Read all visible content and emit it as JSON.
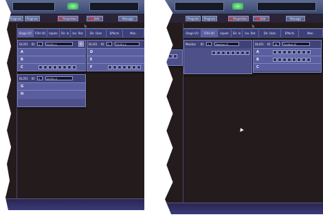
{
  "panels": [
    {
      "toolbar": {
        "tb1": "Program",
        "tb2": "Program",
        "tb3": "Properties",
        "tb4": "Edit",
        "tb5": "Manage"
      },
      "tag": "To",
      "tabs": [
        "Stage I/O",
        "FOH I/O",
        "Inputs",
        "Dir. In",
        "Ins. Ret.",
        "Dir. Outs",
        "Effects",
        "Mon."
      ],
      "groups": [
        {
          "title": "DL351",
          "id_label": "ID",
          "id": "1",
          "name": "DL351-1",
          "rows": [
            "A",
            "B",
            "C"
          ]
        },
        {
          "title": "DL351",
          "id_label": "ID",
          "id": "2",
          "name": "DL351-2",
          "rows": [
            "D",
            "E",
            "F"
          ]
        },
        {
          "title": "DL351",
          "id_label": "ID",
          "id": "3",
          "name": "DL351-3",
          "rows": [
            "G",
            "H"
          ]
        }
      ]
    },
    {
      "toolbar": {
        "tb1": "Program",
        "tb2": "Program",
        "tb3": "Properties",
        "tb4": "Edit",
        "tb5": "Manage"
      },
      "tag": "To",
      "tabs": [
        "Stage I/O",
        "FOH I/O",
        "Inputs",
        "Dir. In",
        "Ins. Ret.",
        "Dir. Outs",
        "Effects",
        "Mon."
      ],
      "groups": [
        {
          "title": "Monitor",
          "id_label": "ID",
          "id": "1",
          "name": "Monitor IO"
        },
        {
          "title": "DL451",
          "id_label": "ID",
          "id": "16",
          "name": "Surface IO",
          "rows": [
            "A",
            "B",
            "C"
          ]
        }
      ]
    }
  ]
}
